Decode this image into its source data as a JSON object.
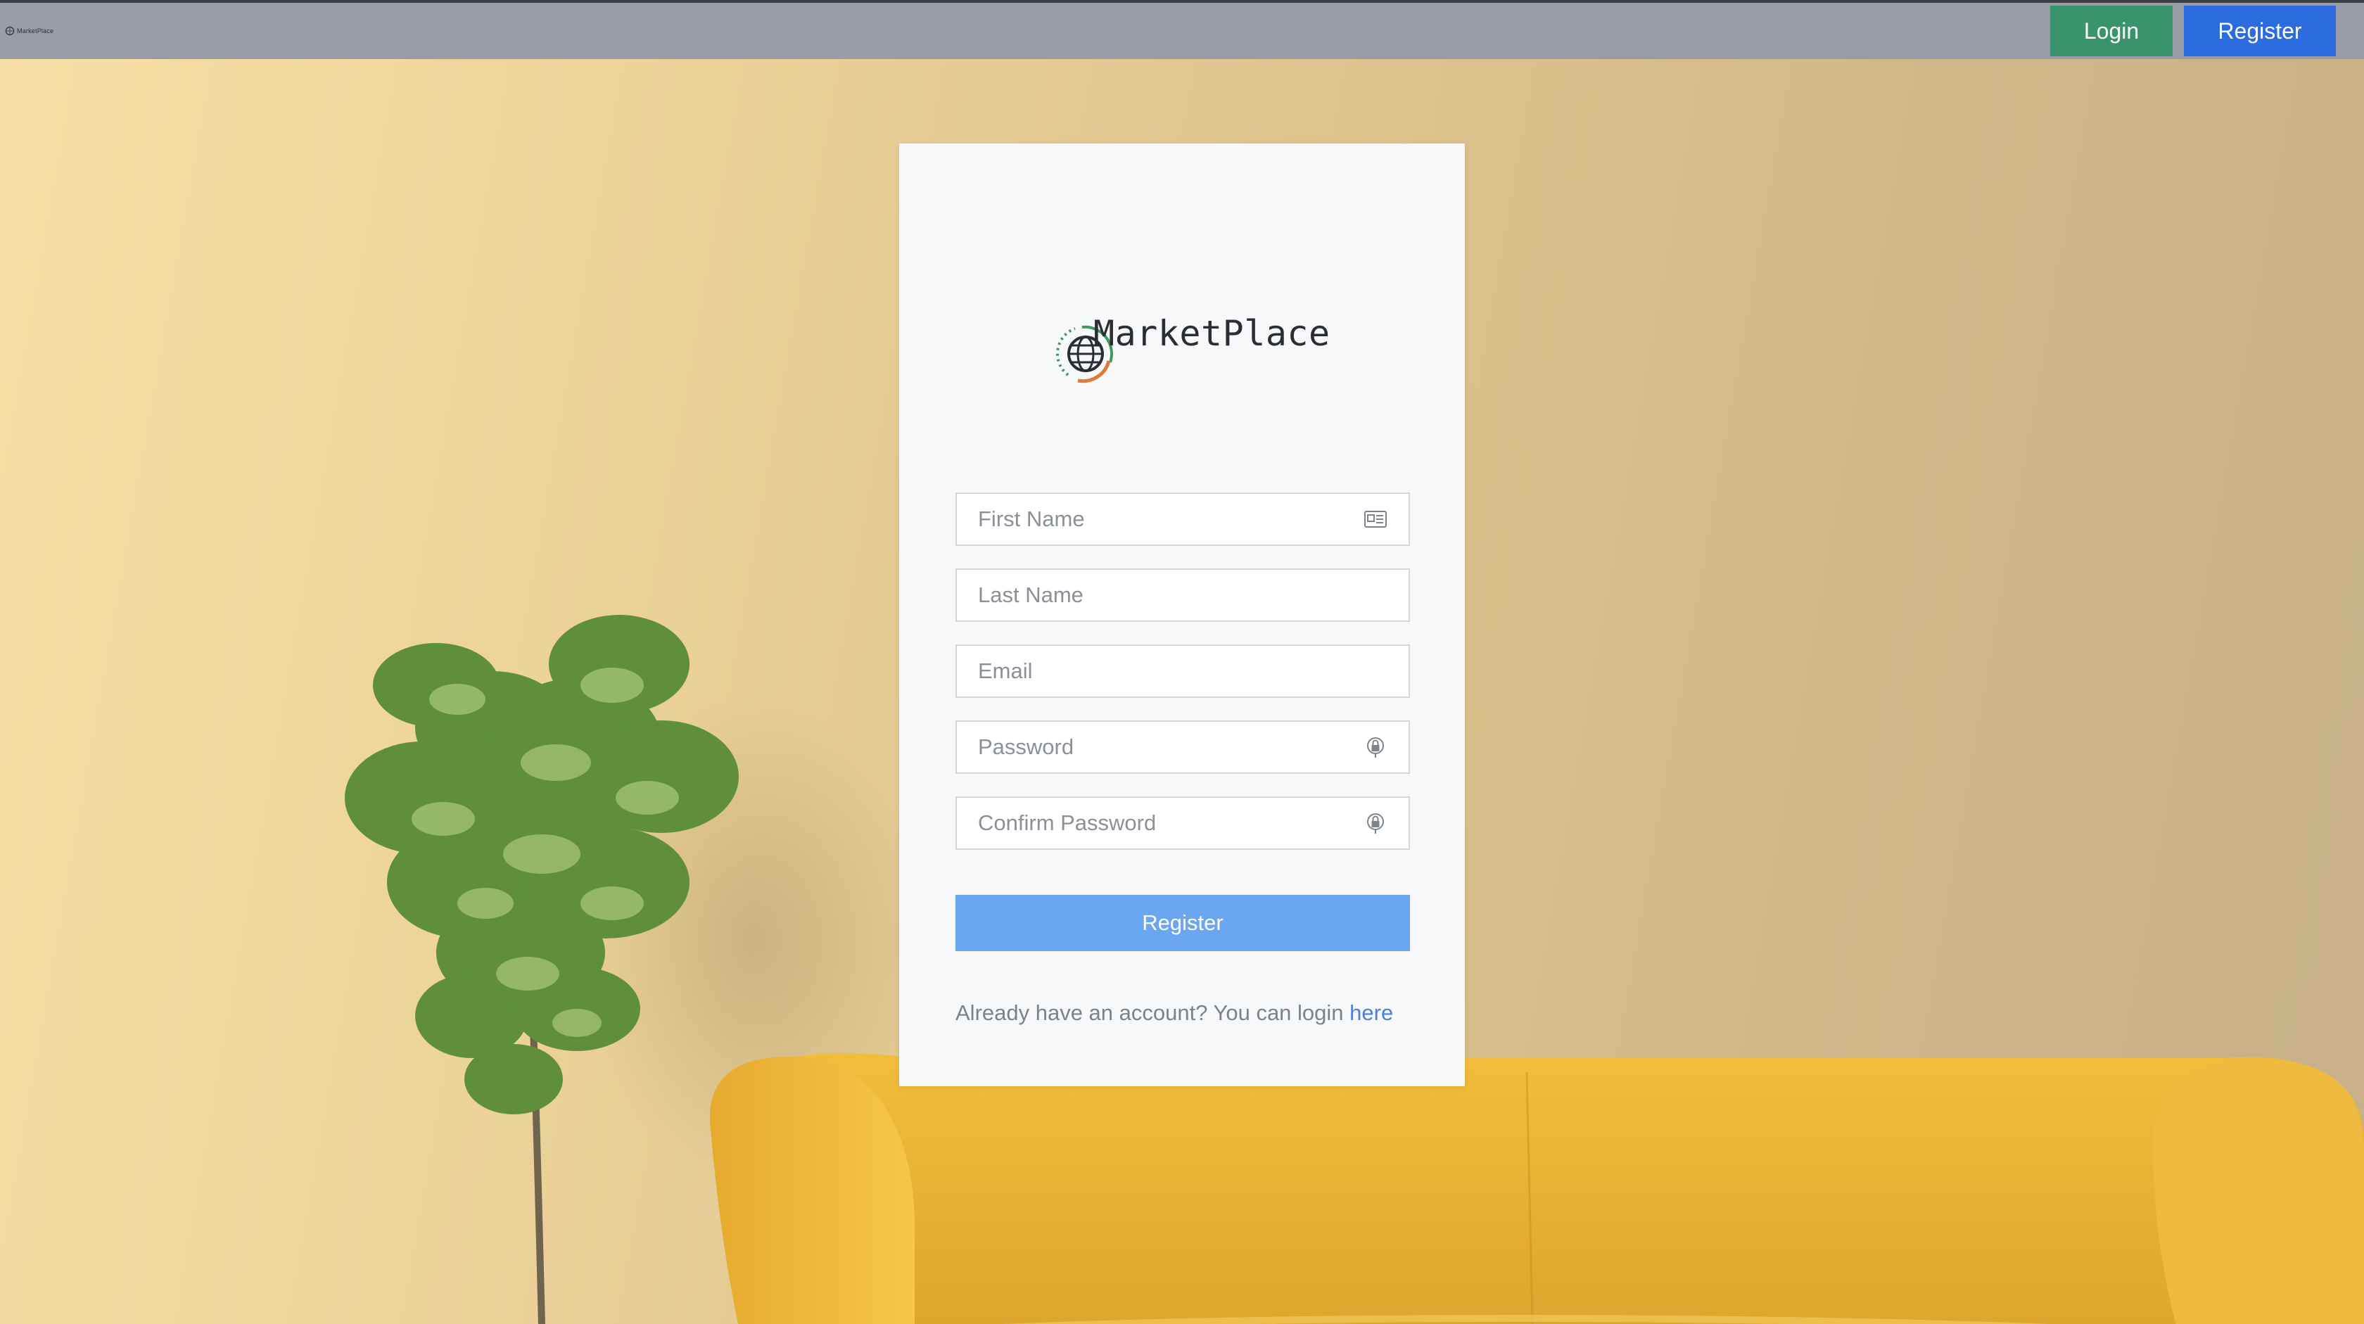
{
  "navbar": {
    "brand_text": "MarketPlace",
    "login_label": "Login",
    "register_label": "Register"
  },
  "card": {
    "logo_text": "MarketPlace",
    "fields": {
      "first_name_placeholder": "First Name",
      "last_name_placeholder": "Last Name",
      "email_placeholder": "Email",
      "password_placeholder": "Password",
      "confirm_password_placeholder": "Confirm Password"
    },
    "submit_label": "Register",
    "footer": {
      "prefix": "Already have an account? You can login ",
      "link_label": "here"
    }
  },
  "icons": {
    "first_name": "id-card-icon",
    "password": "lock-icon",
    "confirm_password": "lock-icon"
  },
  "colors": {
    "navbar_bg": "#979ca6",
    "login_button": "#3a946b",
    "register_button": "#2d6be0",
    "submit_button": "#6aa6f2",
    "link": "#4a7fe0",
    "card_bg": "#f7f8fa"
  }
}
